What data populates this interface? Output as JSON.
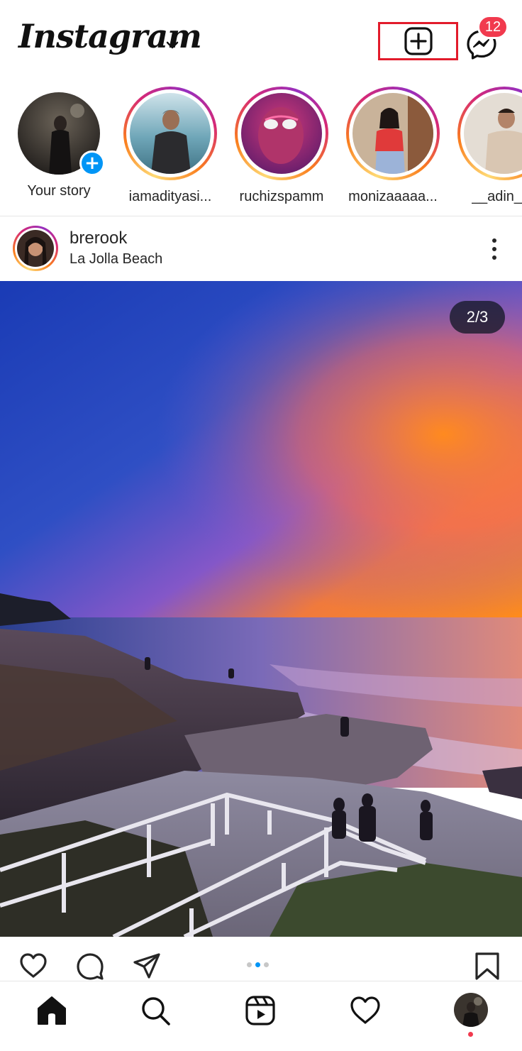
{
  "header": {
    "logo_text": "Instagram",
    "new_post_icon": "plus-square-icon",
    "messenger_icon": "messenger-icon",
    "messenger_badge": "12",
    "highlight_color": "#e21b2b"
  },
  "stories": [
    {
      "label": "Your story",
      "own": true
    },
    {
      "label": "iamadityasi..."
    },
    {
      "label": "ruchizspamm"
    },
    {
      "label": "monizaaaaa..."
    },
    {
      "label": "__adin__s"
    }
  ],
  "post": {
    "username": "brerook",
    "location": "La Jolla Beach",
    "image_counter": "2/3",
    "carousel": {
      "count": 3,
      "active": 2
    }
  },
  "actions": {
    "like_icon": "heart-icon",
    "comment_icon": "comment-icon",
    "share_icon": "send-icon",
    "save_icon": "bookmark-icon"
  },
  "bottom_nav": {
    "items": [
      "home-icon",
      "search-icon",
      "reels-icon",
      "activity-heart-icon",
      "profile-avatar"
    ]
  },
  "colors": {
    "accent_blue": "#0095f6",
    "notification_red": "#f13a4e"
  }
}
